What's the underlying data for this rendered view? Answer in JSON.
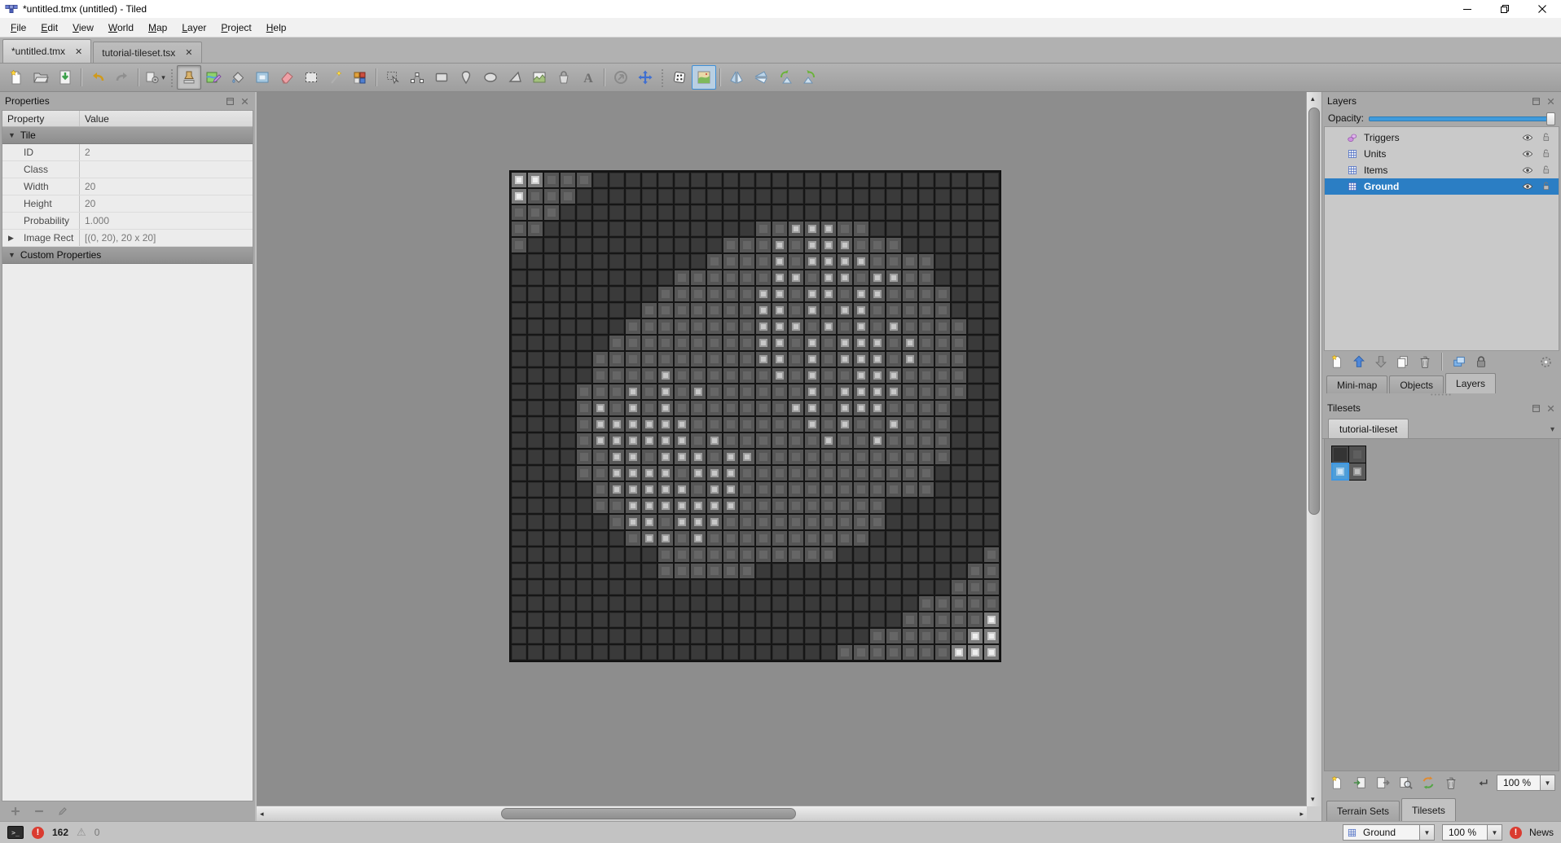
{
  "window": {
    "title": "*untitled.tmx (untitled) - Tiled",
    "controls": [
      "minimize",
      "restore",
      "close"
    ]
  },
  "menu": [
    "File",
    "Edit",
    "View",
    "World",
    "Map",
    "Layer",
    "Project",
    "Help"
  ],
  "document_tabs": [
    {
      "label": "*untitled.tmx",
      "active": true
    },
    {
      "label": "tutorial-tileset.tsx",
      "active": false
    }
  ],
  "toolbar": {
    "items": [
      {
        "type": "button",
        "name": "new-file"
      },
      {
        "type": "button",
        "name": "open-file"
      },
      {
        "type": "button",
        "name": "save-file"
      },
      {
        "type": "sep"
      },
      {
        "type": "button",
        "name": "undo"
      },
      {
        "type": "button",
        "name": "redo"
      },
      {
        "type": "sep"
      },
      {
        "type": "button",
        "name": "commands",
        "dropdown": true
      },
      {
        "type": "handle"
      },
      {
        "type": "button",
        "name": "stamp-brush",
        "active": true
      },
      {
        "type": "button",
        "name": "terrain-brush"
      },
      {
        "type": "button",
        "name": "bucket-fill"
      },
      {
        "type": "button",
        "name": "shape-fill"
      },
      {
        "type": "button",
        "name": "eraser"
      },
      {
        "type": "button",
        "name": "rect-select"
      },
      {
        "type": "button",
        "name": "magic-wand"
      },
      {
        "type": "button",
        "name": "same-tile-select"
      },
      {
        "type": "sep"
      },
      {
        "type": "button",
        "name": "select-objects"
      },
      {
        "type": "button",
        "name": "edit-polygons"
      },
      {
        "type": "button",
        "name": "insert-rectangle"
      },
      {
        "type": "button",
        "name": "insert-point"
      },
      {
        "type": "button",
        "name": "insert-ellipse"
      },
      {
        "type": "button",
        "name": "insert-polygon"
      },
      {
        "type": "button",
        "name": "insert-tile"
      },
      {
        "type": "button",
        "name": "insert-template"
      },
      {
        "type": "button",
        "name": "insert-text"
      },
      {
        "type": "sep"
      },
      {
        "type": "button",
        "name": "circle-arrow"
      },
      {
        "type": "button",
        "name": "offset-layers"
      },
      {
        "type": "handle"
      },
      {
        "type": "button",
        "name": "random-mode"
      },
      {
        "type": "button",
        "name": "terrain-fill-mode",
        "active_blue": true
      },
      {
        "type": "sep"
      },
      {
        "type": "button",
        "name": "flip-horizontal"
      },
      {
        "type": "button",
        "name": "flip-vertical"
      },
      {
        "type": "button",
        "name": "rotate-left"
      },
      {
        "type": "button",
        "name": "rotate-right"
      }
    ]
  },
  "properties_panel": {
    "title": "Properties",
    "columns": [
      "Property",
      "Value"
    ],
    "groups": [
      {
        "label": "Tile",
        "rows": [
          {
            "name": "ID",
            "value": "2"
          },
          {
            "name": "Class",
            "value": ""
          },
          {
            "name": "Width",
            "value": "20"
          },
          {
            "name": "Height",
            "value": "20"
          },
          {
            "name": "Probability",
            "value": "1.000"
          },
          {
            "name": "Image Rect",
            "value": "[(0, 20), 20 x 20]",
            "expandable": true
          }
        ]
      },
      {
        "label": "Custom Properties",
        "rows": []
      }
    ]
  },
  "map_view": {
    "columns": 30,
    "rows": 30,
    "tile_size": 20,
    "legend": {
      ".": "tile-0-dark",
      "a": "tile-1-mid",
      "b": "tile-3-light-center",
      "c": "tile-2-bright-center"
    },
    "grid": [
      "ccaaa.........................",
      "caaa..........................",
      "aaa...........................",
      "aa.............aabbbaa........",
      "a............aaababbbaaa......",
      "............aaaababbbbaaaa....",
      "..........aaaaaabbabbabbaa....",
      ".........aaaaaabbabbabbaaaa...",
      "........aaaaaaabbababbaaaaa...",
      ".......aaaaaaaabbbabababaaaa..",
      "......aaaaaaaaabbababbbabaaa..",
      ".....aaaaaaaaaabbababbbabaaa..",
      ".....aaaabaaaaaababaabbbaaaa..",
      "....aaabababaaaaaababbbbaaaa..",
      "....abababaaaaaaabbabbbaaaa...",
      "....abbbbbbaaaaaaababaabaaa...",
      "....abbbbbbabaaaaaabaabaaaa...",
      "....aabbabbbabbaaaaaaaaaaaa...",
      "....aabbbbabbbaaaaaaaaaaaa....",
      ".....abbbbbabbaaaaaaaaaaaa....",
      ".....aabbbbbbbaaaaaaaaa.......",
      "......abbabbbaaaaaaaaaa.......",
      ".......abbabaaaaaaaaaa........",
      ".........aaaaaaaaaaa.........a",
      ".........aaaaaa.............aa",
      "...........................aaa",
      ".........................aaaaa",
      "........................aaaaac",
      "......................aaaaaacc",
      "....................aaaaaaaccc"
    ]
  },
  "layers_panel": {
    "title": "Layers",
    "opacity_label": "Opacity:",
    "layers": [
      {
        "name": "Triggers",
        "type": "object",
        "selected": false
      },
      {
        "name": "Units",
        "type": "tile",
        "selected": false
      },
      {
        "name": "Items",
        "type": "tile",
        "selected": false
      },
      {
        "name": "Ground",
        "type": "tile",
        "selected": true
      }
    ],
    "toolbar": [
      "new-layer",
      "raise-layer",
      "lower-layer",
      "duplicate-layer",
      "remove-layer",
      "|",
      "highlight-layer",
      "lock-layer"
    ]
  },
  "dock_tabs": {
    "items": [
      "Mini-map",
      "Objects",
      "Layers"
    ],
    "active": "Layers"
  },
  "tilesets_panel": {
    "title": "Tilesets",
    "tab": "tutorial-tileset",
    "tiles": [
      "tile-0-dark",
      "tile-1-mid",
      "tile-2-bright-selected",
      "tile-3-light"
    ],
    "toolbar": [
      "new-tileset",
      "embed-tileset",
      "export-tileset",
      "edit-tileset",
      "replace-tileset",
      "remove-tileset"
    ],
    "zoom": "100 %"
  },
  "bottom_tabs": {
    "items": [
      "Terrain Sets",
      "Tilesets"
    ],
    "active": "Tilesets"
  },
  "status_bar": {
    "errors": "162",
    "warnings": "0",
    "layer_combo": "Ground",
    "zoom_combo": "100 %",
    "news_label": "News"
  }
}
